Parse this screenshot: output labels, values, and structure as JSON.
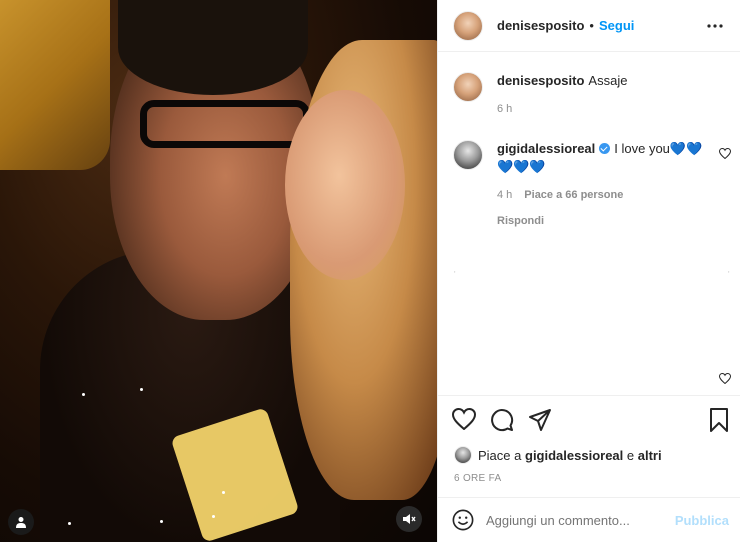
{
  "post": {
    "author": "denisesposito",
    "separator": "•",
    "follow_label": "Segui",
    "more_icon": "more-horizontal-icon"
  },
  "caption": {
    "user": "denisesposito",
    "text": "Assaje",
    "time": "6 h"
  },
  "comments": [
    {
      "user": "gigidalessioreal",
      "verified": true,
      "text": "I love you💙💙💙💙💙",
      "time": "4 h",
      "likes": "Piace a 66 persone",
      "reply": "Rispondi"
    }
  ],
  "actions": {
    "like_icon": "heart-icon",
    "comment_icon": "comment-icon",
    "share_icon": "send-icon",
    "save_icon": "bookmark-icon"
  },
  "likes": {
    "prefix": "Piace a",
    "user": "gigidalessioreal",
    "connector": "e",
    "suffix": "altri"
  },
  "timestamp": "6 ORE FA",
  "add_comment": {
    "placeholder": "Aggiungi un commento...",
    "post_label": "Pubblica"
  },
  "colors": {
    "link_blue": "#0095f6",
    "post_disabled": "#b2dffc",
    "meta_gray": "#8e8e8e"
  }
}
